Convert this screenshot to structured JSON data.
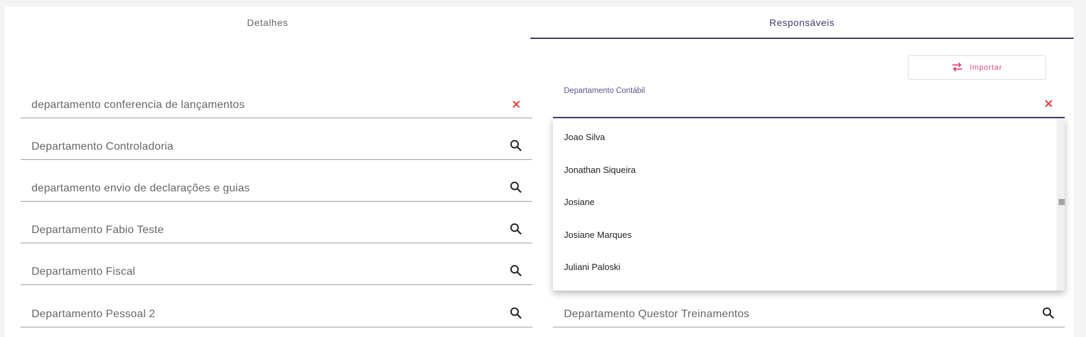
{
  "tabs": [
    {
      "label": "Detalhes",
      "active": false
    },
    {
      "label": "Responsáveis",
      "active": true
    }
  ],
  "import_button": {
    "label": "Importar",
    "icon": "swap-arrows-icon",
    "color": "#e0457b"
  },
  "left_fields": [
    {
      "value": "departamento conferencia de lançamentos",
      "icon": "clear-icon"
    },
    {
      "value": "Departamento Controladoria",
      "icon": "search-icon"
    },
    {
      "value": "departamento envio de declarações e guias",
      "icon": "search-icon"
    },
    {
      "value": "Departamento Fabio Teste",
      "icon": "search-icon"
    },
    {
      "value": "Departamento Fiscal",
      "icon": "search-icon"
    },
    {
      "value": "Departamento Pessoal 2",
      "icon": "search-icon"
    }
  ],
  "active_field": {
    "label": "Departamento Contábil",
    "value": "",
    "icon": "clear-icon"
  },
  "dropdown_options": [
    "Joao Silva",
    "Jonathan Siqueira",
    "Josiane",
    "Josiane Marques",
    "Juliani Paloski"
  ],
  "bottom_right_field": {
    "value": "Departamento Questor Treinamentos",
    "icon": "search-icon"
  },
  "colors": {
    "accent": "#3d3a6e",
    "danger": "#e53935",
    "import": "#e0457b"
  }
}
